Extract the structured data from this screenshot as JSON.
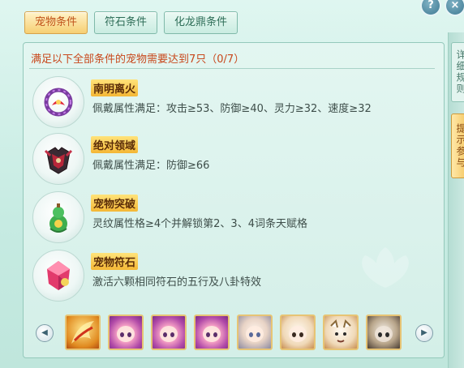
{
  "tabs": [
    {
      "label": "宠物条件",
      "active": true
    },
    {
      "label": "符石条件",
      "active": false
    },
    {
      "label": "化龙鼎条件",
      "active": false
    }
  ],
  "corner_buttons": {
    "help": "?",
    "close": "×"
  },
  "side_strip": {
    "box1": "详细规则",
    "box2": "提示参与"
  },
  "header": "满足以下全部条件的宠物需要达到7只（0/7）",
  "conditions": [
    {
      "icon": "ring-icon",
      "title": "南明离火",
      "desc": "佩戴属性满足：攻击≥53、防御≥40、灵力≥32、速度≥32"
    },
    {
      "icon": "armor-icon",
      "title": "绝对领域",
      "desc": "佩戴属性满足：防御≥66"
    },
    {
      "icon": "gourd-icon",
      "title": "宠物突破",
      "desc": "灵纹属性格≥4个并解锁第2、3、4词条天赋格"
    },
    {
      "icon": "rune-stone-icon",
      "title": "宠物符石",
      "desc": "激活六颗相同符石的五行及八卦特效"
    }
  ],
  "pet_bar": {
    "prev_icon": "arrow-left-icon",
    "next_icon": "arrow-right-icon",
    "avatars": [
      "phoenix",
      "pink-girl",
      "pink-girl",
      "pink-girl",
      "white-hair-girl",
      "ghost-child",
      "white-tiger",
      "dark-warrior"
    ]
  },
  "colors": {
    "accent": "#c8481c",
    "badge": "#f4b735",
    "panel": "#d4efe8"
  }
}
